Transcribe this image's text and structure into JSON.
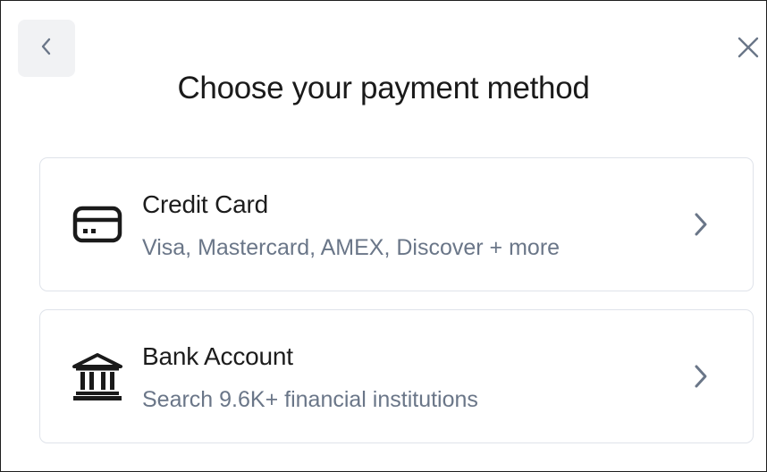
{
  "header": {
    "title": "Choose your payment method",
    "back_icon": "chevron-left-icon",
    "close_icon": "close-icon"
  },
  "options": [
    {
      "title": "Credit Card",
      "subtitle": "Visa, Mastercard, AMEX, Discover + more",
      "icon": "credit-card-icon",
      "chevron": "chevron-right-icon"
    },
    {
      "title": "Bank Account",
      "subtitle": "Search 9.6K+ financial institutions",
      "icon": "bank-icon",
      "chevron": "chevron-right-icon"
    }
  ],
  "colors": {
    "title_text": "#1a1a1a",
    "subtitle_text": "#6a7688",
    "chevron": "#6a7688",
    "card_border": "#dfe3ea",
    "back_button_bg": "#f1f2f4"
  }
}
